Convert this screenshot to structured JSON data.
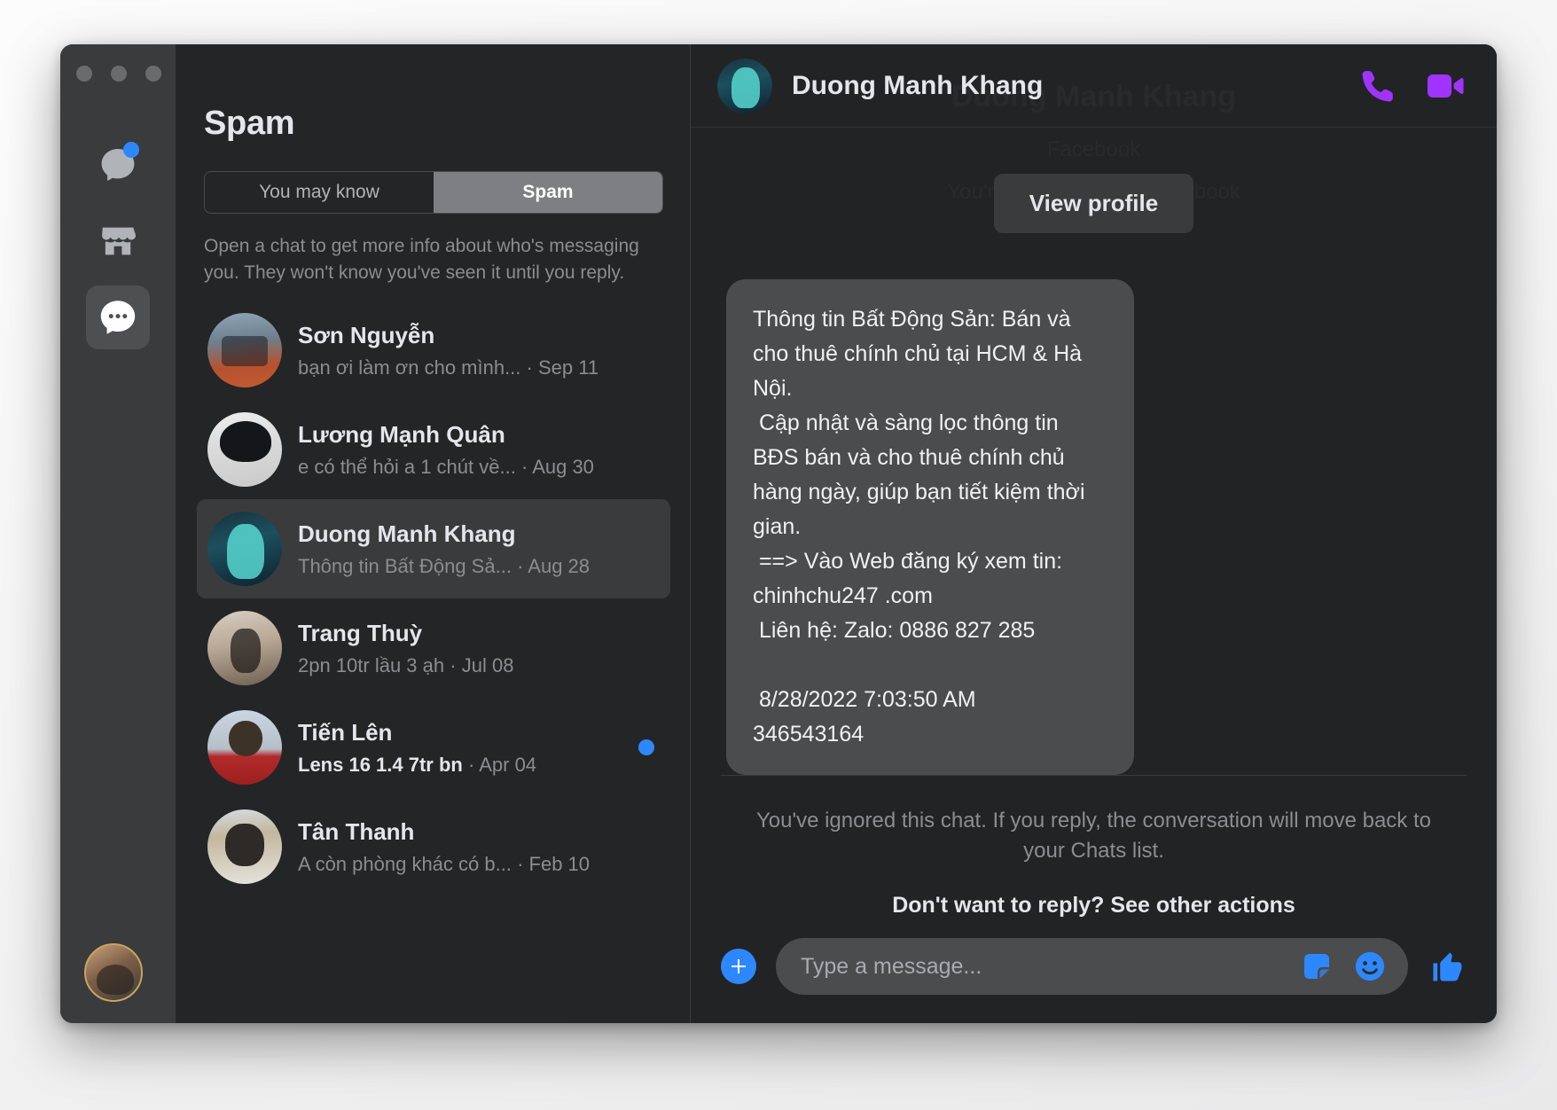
{
  "window": {
    "traffic_lights": [
      "close",
      "minimize",
      "zoom"
    ]
  },
  "rail": {
    "items": [
      {
        "name": "chats-rail-icon",
        "label": "Chats",
        "has_badge": true
      },
      {
        "name": "marketplace-rail-icon",
        "label": "Marketplace",
        "has_badge": false
      },
      {
        "name": "message-requests-rail-icon",
        "label": "Message requests",
        "has_badge": false,
        "active": true
      }
    ],
    "account_avatar_label": "Your profile"
  },
  "list": {
    "title": "Spam",
    "tabs": [
      {
        "label": "You may know",
        "active": false
      },
      {
        "label": "Spam",
        "active": true
      }
    ],
    "note": "Open a chat to get more info about who's messaging you. They won't know you've seen it until you reply.",
    "rows": [
      {
        "name": "Sơn Nguyễn",
        "preview": "bạn ơi làm ơn cho mình...",
        "separator": "·",
        "date": "Sep 11",
        "unread": false,
        "selected": false,
        "avatar_class": "av-a"
      },
      {
        "name": "Lương Mạnh Quân",
        "preview": "e có thể hỏi a 1 chút về...",
        "separator": "·",
        "date": "Aug 30",
        "unread": false,
        "selected": false,
        "avatar_class": "av-b"
      },
      {
        "name": "Duong Manh Khang",
        "preview": "Thông tin Bất Động Sả...",
        "separator": "·",
        "date": "Aug 28",
        "unread": false,
        "selected": true,
        "avatar_class": "av-c"
      },
      {
        "name": "Trang Thuỳ",
        "preview": "2pn 10tr lầu 3 ạh",
        "separator": "·",
        "date": "Jul 08",
        "unread": false,
        "selected": false,
        "avatar_class": "av-d"
      },
      {
        "name": "Tiến Lên",
        "preview": "Lens 16 1.4 7tr bn",
        "separator": "·",
        "date": "Apr 04",
        "unread": true,
        "selected": false,
        "avatar_class": "av-e"
      },
      {
        "name": "Tân Thanh",
        "preview": "A còn phòng khác có b...",
        "separator": "·",
        "date": "Feb 10",
        "unread": false,
        "selected": false,
        "avatar_class": "av-f"
      }
    ]
  },
  "chat": {
    "ghost": {
      "name": "Duong Manh Khang",
      "network": "Facebook",
      "relation": "You're not friends on Facebook"
    },
    "header": {
      "name": "Duong Manh Khang",
      "call_icon": "phone-icon",
      "video_icon": "video-camera-icon"
    },
    "view_profile_label": "View profile",
    "message": "Thông tin Bất Động Sản: Bán và cho thuê chính chủ tại HCM & Hà Nội.\n Cập nhật và sàng lọc thông tin BĐS bán và cho thuê chính chủ hàng ngày, giúp bạn tiết kiệm thời gian.\n ==> Vào Web đăng ký xem tin: chinhchu247 .com\n Liên hệ: Zalo: 0886 827 285\n\n 8/28/2022 7:03:50 AM\n346543164",
    "notice": "You've ignored this chat. If you reply, the conversation will move back to your Chats list.",
    "other_actions_label": "Don't want to reply? See other actions",
    "composer": {
      "add_label": "+",
      "placeholder": "Type a message...",
      "sticker_icon": "sticker-icon",
      "emoji_icon": "emoji-icon",
      "like_icon": "thumbs-up-icon"
    }
  },
  "colors": {
    "accent_blue": "#2d88ff",
    "call_purple": "#a033ff",
    "window_bg": "#242526",
    "chat_bg": "#222324"
  }
}
